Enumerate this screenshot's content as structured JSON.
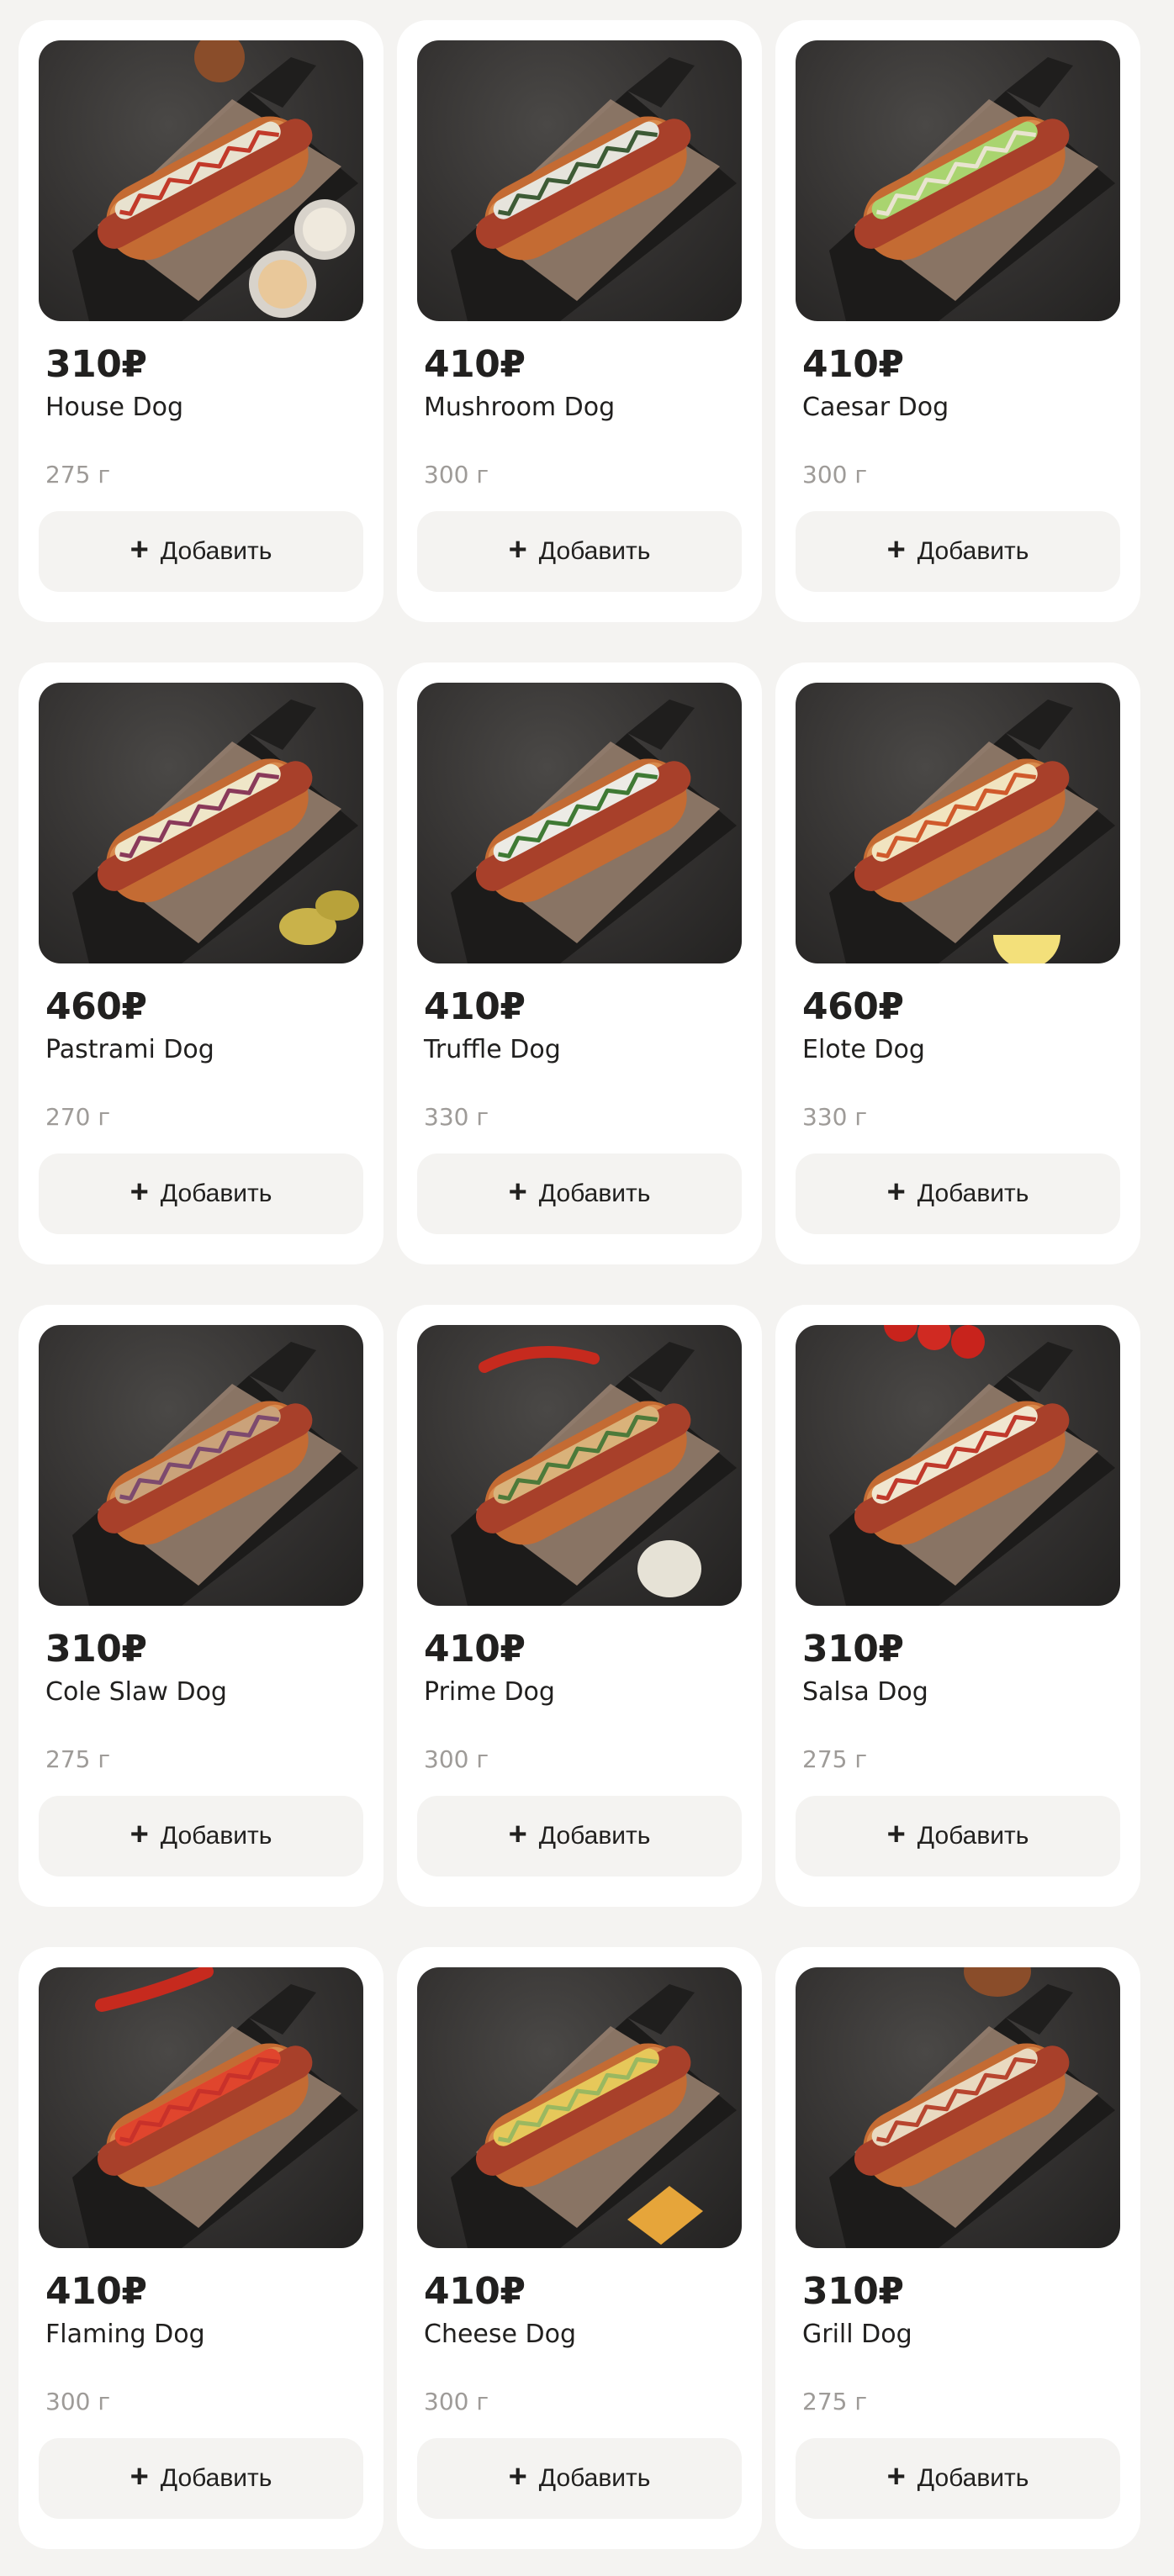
{
  "menu": {
    "add_label": "Добавить",
    "add_icon": "plus-icon",
    "items": [
      {
        "id": "house-dog",
        "price": "310₽",
        "name": "House Dog",
        "weight": "275 г",
        "topping": "#e8e2cf",
        "accent": "#c23a2a",
        "extra": "sauce-cups"
      },
      {
        "id": "mushroom-dog",
        "price": "410₽",
        "name": "Mushroom Dog",
        "weight": "300 г",
        "topping": "#e6e4dc",
        "accent": "#3d5b35",
        "extra": "none"
      },
      {
        "id": "caesar-dog",
        "price": "410₽",
        "name": "Caesar Dog",
        "weight": "300 г",
        "topping": "#a9d46f",
        "accent": "#e9e4d0",
        "extra": "none"
      },
      {
        "id": "pastrami-dog",
        "price": "460₽",
        "name": "Pastrami Dog",
        "weight": "270 г",
        "topping": "#efe6c8",
        "accent": "#8a3a5a",
        "extra": "pickles"
      },
      {
        "id": "truffle-dog",
        "price": "410₽",
        "name": "Truffle Dog",
        "weight": "330 г",
        "topping": "#ecebe5",
        "accent": "#3f7a34",
        "extra": "none"
      },
      {
        "id": "elote-dog",
        "price": "460₽",
        "name": "Elote Dog",
        "weight": "330 г",
        "topping": "#f1e4c0",
        "accent": "#d05a2c",
        "extra": "lemon"
      },
      {
        "id": "cole-slaw-dog",
        "price": "310₽",
        "name": "Cole Slaw Dog",
        "weight": "275 г",
        "topping": "#caa27a",
        "accent": "#7d4a6e",
        "extra": "none"
      },
      {
        "id": "prime-dog",
        "price": "410₽",
        "name": "Prime Dog",
        "weight": "300 г",
        "topping": "#d9b27a",
        "accent": "#4d7a3a",
        "extra": "chili-garlic"
      },
      {
        "id": "salsa-dog",
        "price": "310₽",
        "name": "Salsa Dog",
        "weight": "275 г",
        "topping": "#f0e6d0",
        "accent": "#c0392b",
        "extra": "tomatoes"
      },
      {
        "id": "flaming-dog",
        "price": "410₽",
        "name": "Flaming Dog",
        "weight": "300 г",
        "topping": "#e0452d",
        "accent": "#c8312a",
        "extra": "chili"
      },
      {
        "id": "cheese-dog",
        "price": "410₽",
        "name": "Cheese Dog",
        "weight": "300 г",
        "topping": "#e6c85a",
        "accent": "#9ab860",
        "extra": "cheese"
      },
      {
        "id": "grill-dog",
        "price": "310₽",
        "name": "Grill Dog",
        "weight": "275 г",
        "topping": "#e9d9c0",
        "accent": "#b8452f",
        "extra": "onion"
      }
    ]
  }
}
